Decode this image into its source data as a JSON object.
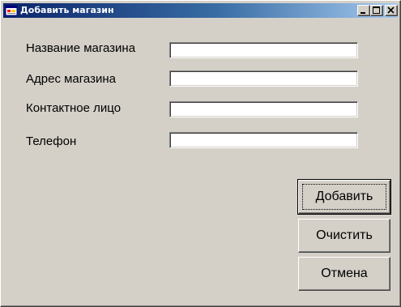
{
  "window": {
    "title": "Добавить магазин",
    "controls": {
      "minimize_icon": "minimize-icon",
      "maximize_icon": "maximize-icon",
      "close_icon": "close-icon"
    }
  },
  "form": {
    "fields": [
      {
        "label": "Название магазина",
        "value": "",
        "placeholder": ""
      },
      {
        "label": "Адрес магазина",
        "value": "",
        "placeholder": ""
      },
      {
        "label": "Контактное лицо",
        "value": "",
        "placeholder": ""
      },
      {
        "label": "Телефон",
        "value": "",
        "placeholder": ""
      }
    ]
  },
  "buttons": {
    "add_label": "Добавить",
    "clear_label": "Очистить",
    "cancel_label": "Отмена"
  },
  "colors": {
    "face": "#d4d0c8",
    "title_start": "#0a246a",
    "title_end": "#a6caf0"
  }
}
